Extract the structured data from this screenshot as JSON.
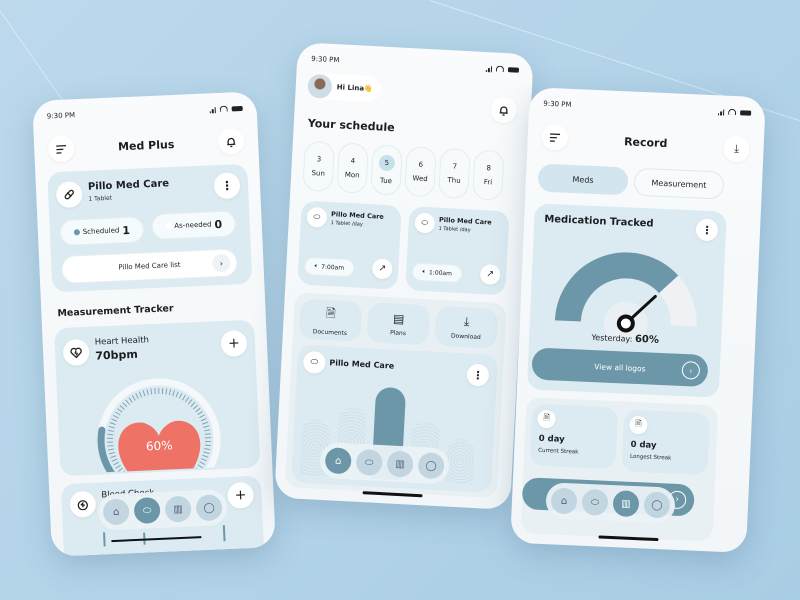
{
  "phone1": {
    "status_time": "9:30 PM",
    "title": "Med Plus",
    "med_card": {
      "name": "Pillo Med Care",
      "dose": "1 Tablet",
      "scheduled_label": "Scheduled",
      "scheduled_count": "1",
      "asneeded_label": "As-needed",
      "asneeded_count": "0",
      "list_button": "Pillo Med Care list"
    },
    "section_title": "Measurement Tracker",
    "heart_card": {
      "title": "Heart Health",
      "value": "70bpm",
      "percent_label": "60%",
      "gauge_fraction": 0.6
    },
    "blood_card": {
      "title": "Blood Check"
    },
    "nav_active": "meds"
  },
  "phone2": {
    "status_time": "9:30 PM",
    "greeting": "Hi Lina👋",
    "section_title": "Your schedule",
    "days": [
      {
        "num": "3",
        "name": "Sun"
      },
      {
        "num": "4",
        "name": "Mon"
      },
      {
        "num": "5",
        "name": "Tue",
        "selected": true
      },
      {
        "num": "6",
        "name": "Wed"
      },
      {
        "num": "7",
        "name": "Thu"
      },
      {
        "num": "8",
        "name": "Fri"
      }
    ],
    "reminders": [
      {
        "name": "Pillo Med Care",
        "dose": "1 Tablet /day",
        "time": "7:00am"
      },
      {
        "name": "Pillo Med Care",
        "dose": "1 Tablet /day",
        "time": "1:00am"
      }
    ],
    "actions": [
      {
        "label": "Documents"
      },
      {
        "label": "Plans"
      },
      {
        "label": "Download"
      }
    ],
    "chart_card": {
      "title": "Pillo Med Care"
    },
    "nav_active": "home"
  },
  "phone3": {
    "status_time": "9:30 PM",
    "title": "Record",
    "tabs": [
      {
        "label": "Meds",
        "active": true
      },
      {
        "label": "Measurement",
        "active": false
      }
    ],
    "tracked_card": {
      "title": "Medication Tracked",
      "yesterday_label": "Yesterday:",
      "yesterday_value": "60%",
      "gauge_fraction": 0.6,
      "view_button": "View all logos"
    },
    "streaks": [
      {
        "value": "0 day",
        "label": "Current Streak"
      },
      {
        "value": "0 day",
        "label": "Longest Streak"
      }
    ],
    "nav_active": "stats"
  },
  "colors": {
    "accent": "#6b97a8",
    "card_bg": "#dceaf1",
    "heart": "#ee7266",
    "background": "#b5d5ea"
  }
}
